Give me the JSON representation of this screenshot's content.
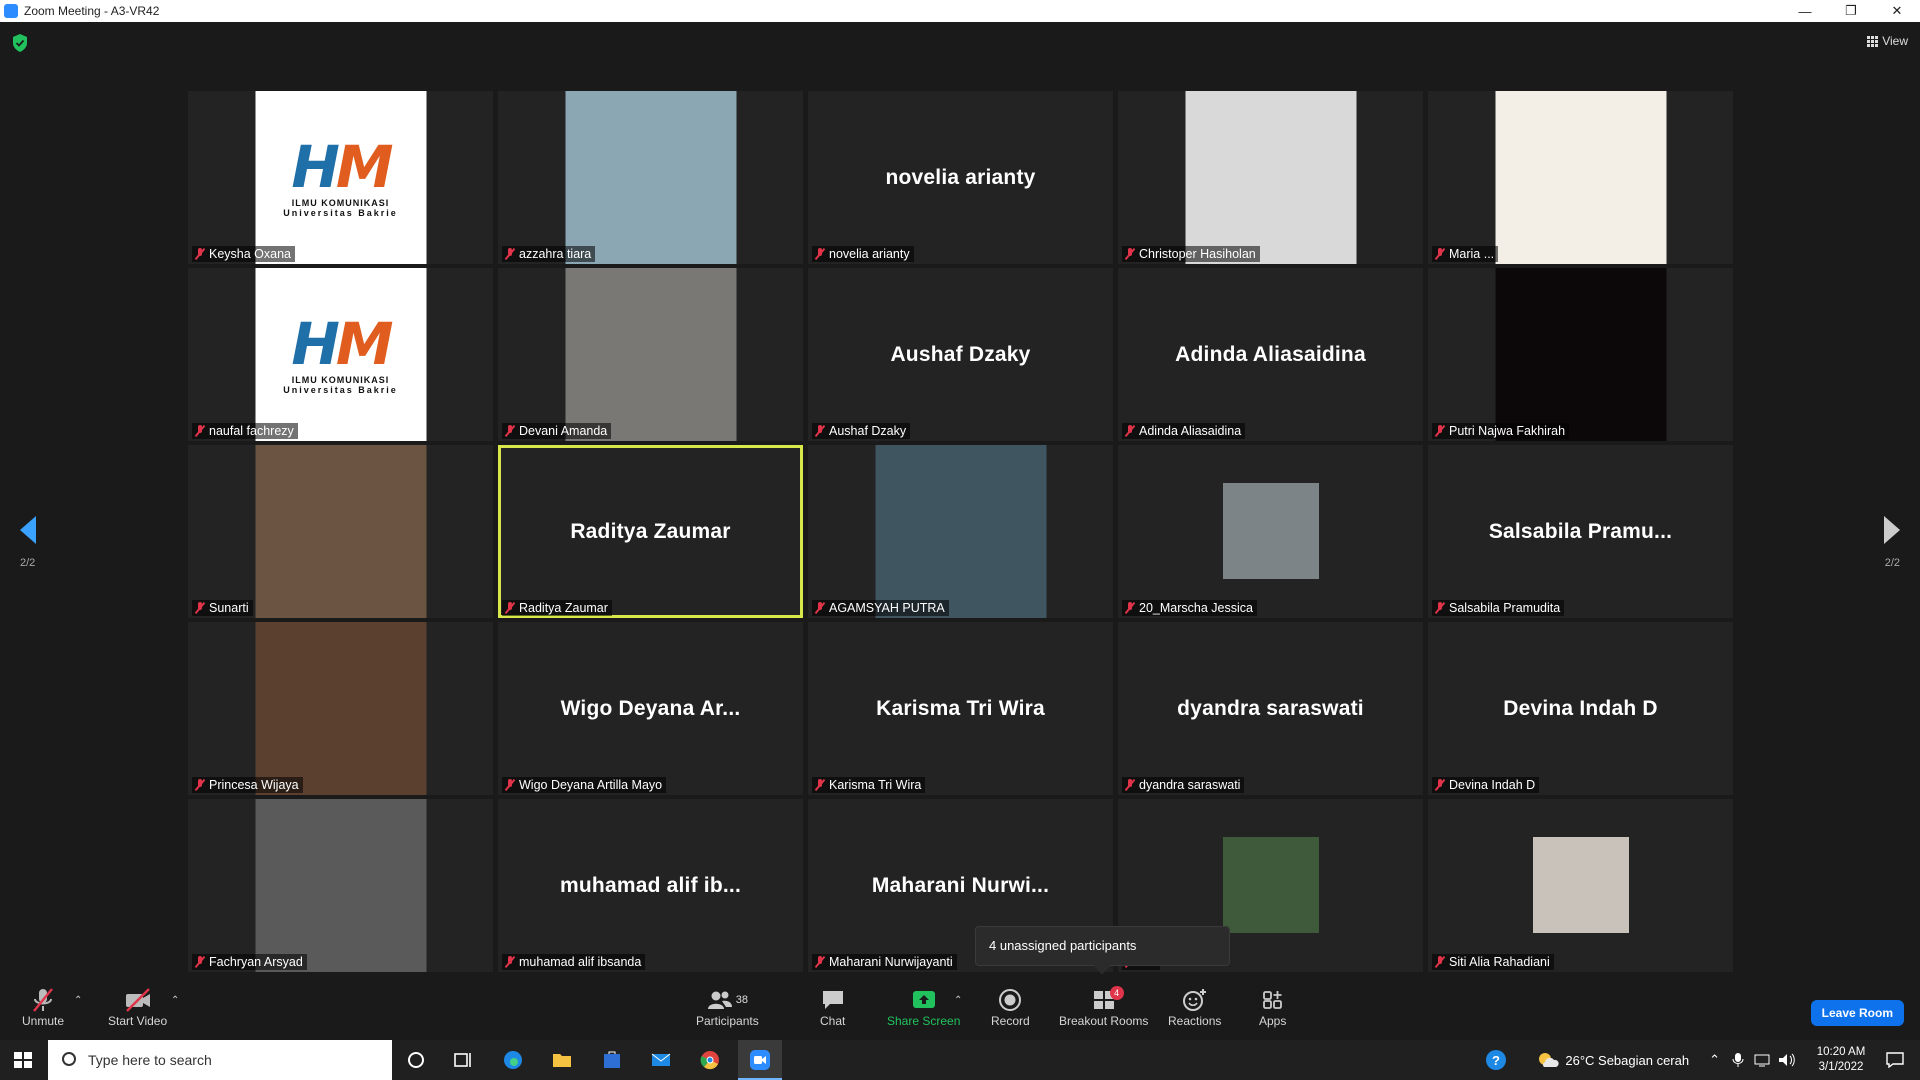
{
  "window": {
    "title": "Zoom Meeting - A3-VR42",
    "controls": [
      "—",
      "❐",
      "✕"
    ]
  },
  "view_label": "View",
  "logo": {
    "letters_h": "H",
    "letters_m": "M",
    "line1": "ILMU KOMUNIKASI",
    "line2": "Universitas Bakrie"
  },
  "tiles": [
    {
      "tag": "Keysha Oxana",
      "big": "",
      "kind": "logo"
    },
    {
      "tag": "azzahra tiara",
      "big": "",
      "kind": "photo",
      "color": "#8aa7b3"
    },
    {
      "tag": "novelia arianty",
      "big": "novelia arianty",
      "kind": "name"
    },
    {
      "tag": "Christoper Hasiholan",
      "big": "",
      "kind": "photo",
      "color": "#d9d9d9"
    },
    {
      "tag": "Maria ...",
      "big": "",
      "kind": "photo",
      "color": "#f3efe6"
    },
    {
      "tag": "naufal fachrezy",
      "big": "",
      "kind": "logo"
    },
    {
      "tag": "Devani Amanda",
      "big": "",
      "kind": "photo",
      "color": "#7a7874"
    },
    {
      "tag": "Aushaf Dzaky",
      "big": "Aushaf Dzaky",
      "kind": "name"
    },
    {
      "tag": "Adinda Aliasaidina",
      "big": "Adinda Aliasaidina",
      "kind": "name"
    },
    {
      "tag": "Putri Najwa Fakhirah",
      "big": "",
      "kind": "photo",
      "color": "#0c0809"
    },
    {
      "tag": "Sunarti",
      "big": "",
      "kind": "photo",
      "color": "#6b5442"
    },
    {
      "tag": "Raditya Zaumar",
      "big": "Raditya Zaumar",
      "kind": "name",
      "active": true
    },
    {
      "tag": "AGAMSYAH PUTRA",
      "big": "",
      "kind": "photo",
      "color": "#3f5560"
    },
    {
      "tag": "20_Marscha Jessica",
      "big": "",
      "kind": "photo-small",
      "color": "#7d8488"
    },
    {
      "tag": "Salsabila Pramudita",
      "big": "Salsabila  Pramu...",
      "kind": "name"
    },
    {
      "tag": "Princesa Wijaya",
      "big": "",
      "kind": "photo",
      "color": "#5b4030"
    },
    {
      "tag": "Wigo Deyana Artilla Mayo",
      "big": "Wigo  Deyana  Ar...",
      "kind": "name"
    },
    {
      "tag": "Karisma Tri Wira",
      "big": "Karisma Tri Wira",
      "kind": "name"
    },
    {
      "tag": "dyandra saraswati",
      "big": "dyandra saraswati",
      "kind": "name"
    },
    {
      "tag": "Devina Indah D",
      "big": "Devina Indah D",
      "kind": "name"
    },
    {
      "tag": "Fachryan Arsyad",
      "big": "",
      "kind": "photo",
      "color": "#5a5a5a"
    },
    {
      "tag": "muhamad alif ibsanda",
      "big": "muhamad  alif  ib...",
      "kind": "name"
    },
    {
      "tag": "Maharani Nurwijayanti",
      "big": "Maharani  Nurwi...",
      "kind": "name"
    },
    {
      "tag": "...n",
      "big": "",
      "kind": "photo-small",
      "color": "#3e5a3a"
    },
    {
      "tag": "Siti Alia Rahadiani",
      "big": "",
      "kind": "photo-small",
      "color": "#c9c2bb"
    }
  ],
  "paging": {
    "left": "2/2",
    "right": "2/2"
  },
  "tooltip": "4 unassigned participants",
  "toolbar": {
    "unmute": "Unmute",
    "start_video": "Start Video",
    "participants": "Participants",
    "participants_count": "38",
    "chat": "Chat",
    "share_screen": "Share Screen",
    "record": "Record",
    "breakout_rooms": "Breakout Rooms",
    "breakout_badge": "4",
    "reactions": "Reactions",
    "apps": "Apps",
    "leave": "Leave Room"
  },
  "taskbar": {
    "search_placeholder": "Type here to search",
    "weather": "26°C  Sebagian cerah",
    "time": "10:20 AM",
    "date": "3/1/2022"
  },
  "colors": {
    "accent_blue": "#0e72ed",
    "share_green": "#21c25e",
    "muted_red": "#e0344a",
    "active_speaker": "#d8e84a"
  }
}
